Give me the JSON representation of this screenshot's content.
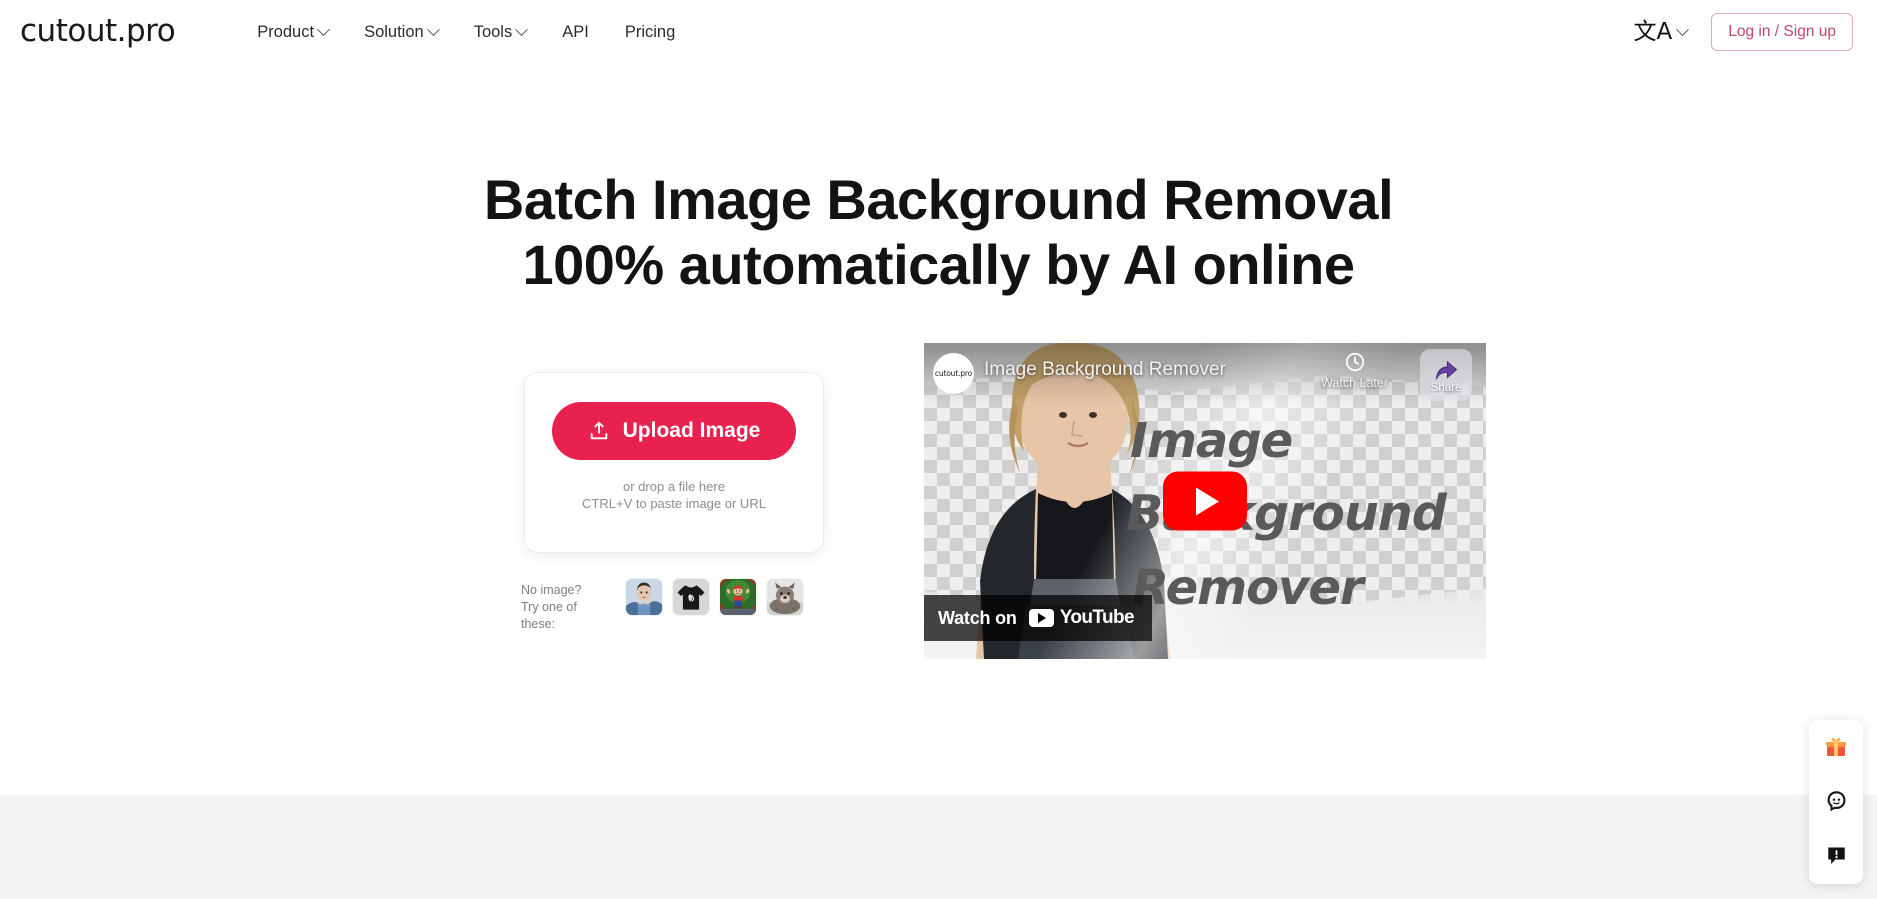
{
  "header": {
    "logo": "cutout.pro",
    "nav": [
      {
        "label": "Product",
        "has_caret": true,
        "icon": "chevron-down-icon"
      },
      {
        "label": "Solution",
        "has_caret": true,
        "icon": "chevron-down-icon"
      },
      {
        "label": "Tools",
        "has_caret": true,
        "icon": "chevron-down-icon"
      },
      {
        "label": "API",
        "has_caret": false
      },
      {
        "label": "Pricing",
        "has_caret": false
      }
    ],
    "language": {
      "glyph": "文A",
      "icon": "translate-icon"
    },
    "login_label": "Log in / Sign up",
    "login_color": "#c2466b"
  },
  "hero": {
    "title_line1": "Batch Image Background Removal",
    "title_line2": "100% automatically by AI online"
  },
  "upload": {
    "button_label": "Upload Image",
    "button_icon": "upload-icon",
    "button_color": "#e8214f",
    "drop_line1": "or drop a file here",
    "drop_line2": "CTRL+V to paste image or URL"
  },
  "samples": {
    "label_line1": "No image?",
    "label_line2": "Try one of these:",
    "thumbs": [
      {
        "name": "sample-portrait",
        "alt": "child in denim jacket"
      },
      {
        "name": "sample-tshirt",
        "alt": "black t-shirt"
      },
      {
        "name": "sample-mario",
        "alt": "mario figurine"
      },
      {
        "name": "sample-dog",
        "alt": "grey dog"
      }
    ]
  },
  "video": {
    "channel_avatar_label": "cutout.pro",
    "title": "Image Background Remover",
    "watch_later_label": "Watch Later",
    "share_label": "Share",
    "watch_on_label": "Watch on",
    "youtube_wordmark": "YouTube",
    "thumbnail_text_line1": "Image",
    "thumbnail_text_line2": "Background",
    "thumbnail_text_line3": "Remover",
    "play_icon": "youtube-play-icon",
    "clock_icon": "clock-icon",
    "share_icon": "share-arrow-icon"
  },
  "float_panel": {
    "buttons": [
      {
        "name": "gift-icon",
        "title": "Gift"
      },
      {
        "name": "support-face-icon",
        "title": "Support"
      },
      {
        "name": "feedback-icon",
        "title": "Feedback"
      }
    ]
  },
  "colors": {
    "accent": "#e8214f",
    "login_border": "#e3a8bb",
    "bottom_band": "#f4f4f5"
  }
}
